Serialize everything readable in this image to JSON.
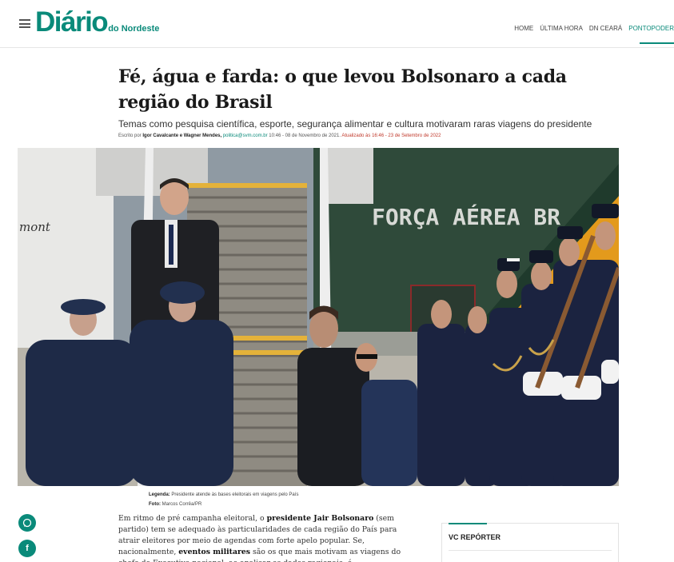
{
  "header": {
    "logo_main": "Diário",
    "logo_sub": "do Nordeste",
    "nav": [
      "HOME",
      "ÚLTIMA HORA",
      "DN CEARÁ",
      "PONTOPODER"
    ]
  },
  "article": {
    "headline": "Fé, água e farda: o que levou Bolsonaro a cada região do Brasil",
    "subtitle": "Temas como pesquisa científica, esporte, segurança alimentar e cultura motivaram raras viagens do presidente",
    "byline_prefix": "Escrito por",
    "authors": "Igor Cavalcante e Wagner Mendes,",
    "email": "politica@svm.com.br",
    "published": "10:46 - 08 de Novembro de 2021.",
    "updated": "Atualizado às 16:46 - 23 de Setembro de 2022",
    "photo_text": "FORÇA AÉREA BR",
    "caption_label": "Legenda:",
    "caption_text": "Presidente atende às bases eleitorais em viagens pelo País",
    "credit_label": "Foto:",
    "credit_text": "Marcos Corrêa/PR",
    "body_1": "Em ritmo de pré campanha eleitoral, o ",
    "body_bold_1": "presidente Jair Bolsonaro",
    "body_2": " (sem partido) tem se adequado às particularidades de cada região do País para atrair eleitores por meio de agendas com forte apelo popular. Se, nacionalmente, ",
    "body_bold_2": "eventos militares",
    "body_3": " são os que mais motivam as viagens do chefe do Executivo nacional, ao analisar os dados regionais, é"
  },
  "social": [
    "whatsapp-icon",
    "facebook-icon"
  ],
  "sidebar": {
    "title": "VC REPÓRTER"
  },
  "colors": {
    "brand": "#0a8a7a",
    "updated": "#c0392b"
  }
}
